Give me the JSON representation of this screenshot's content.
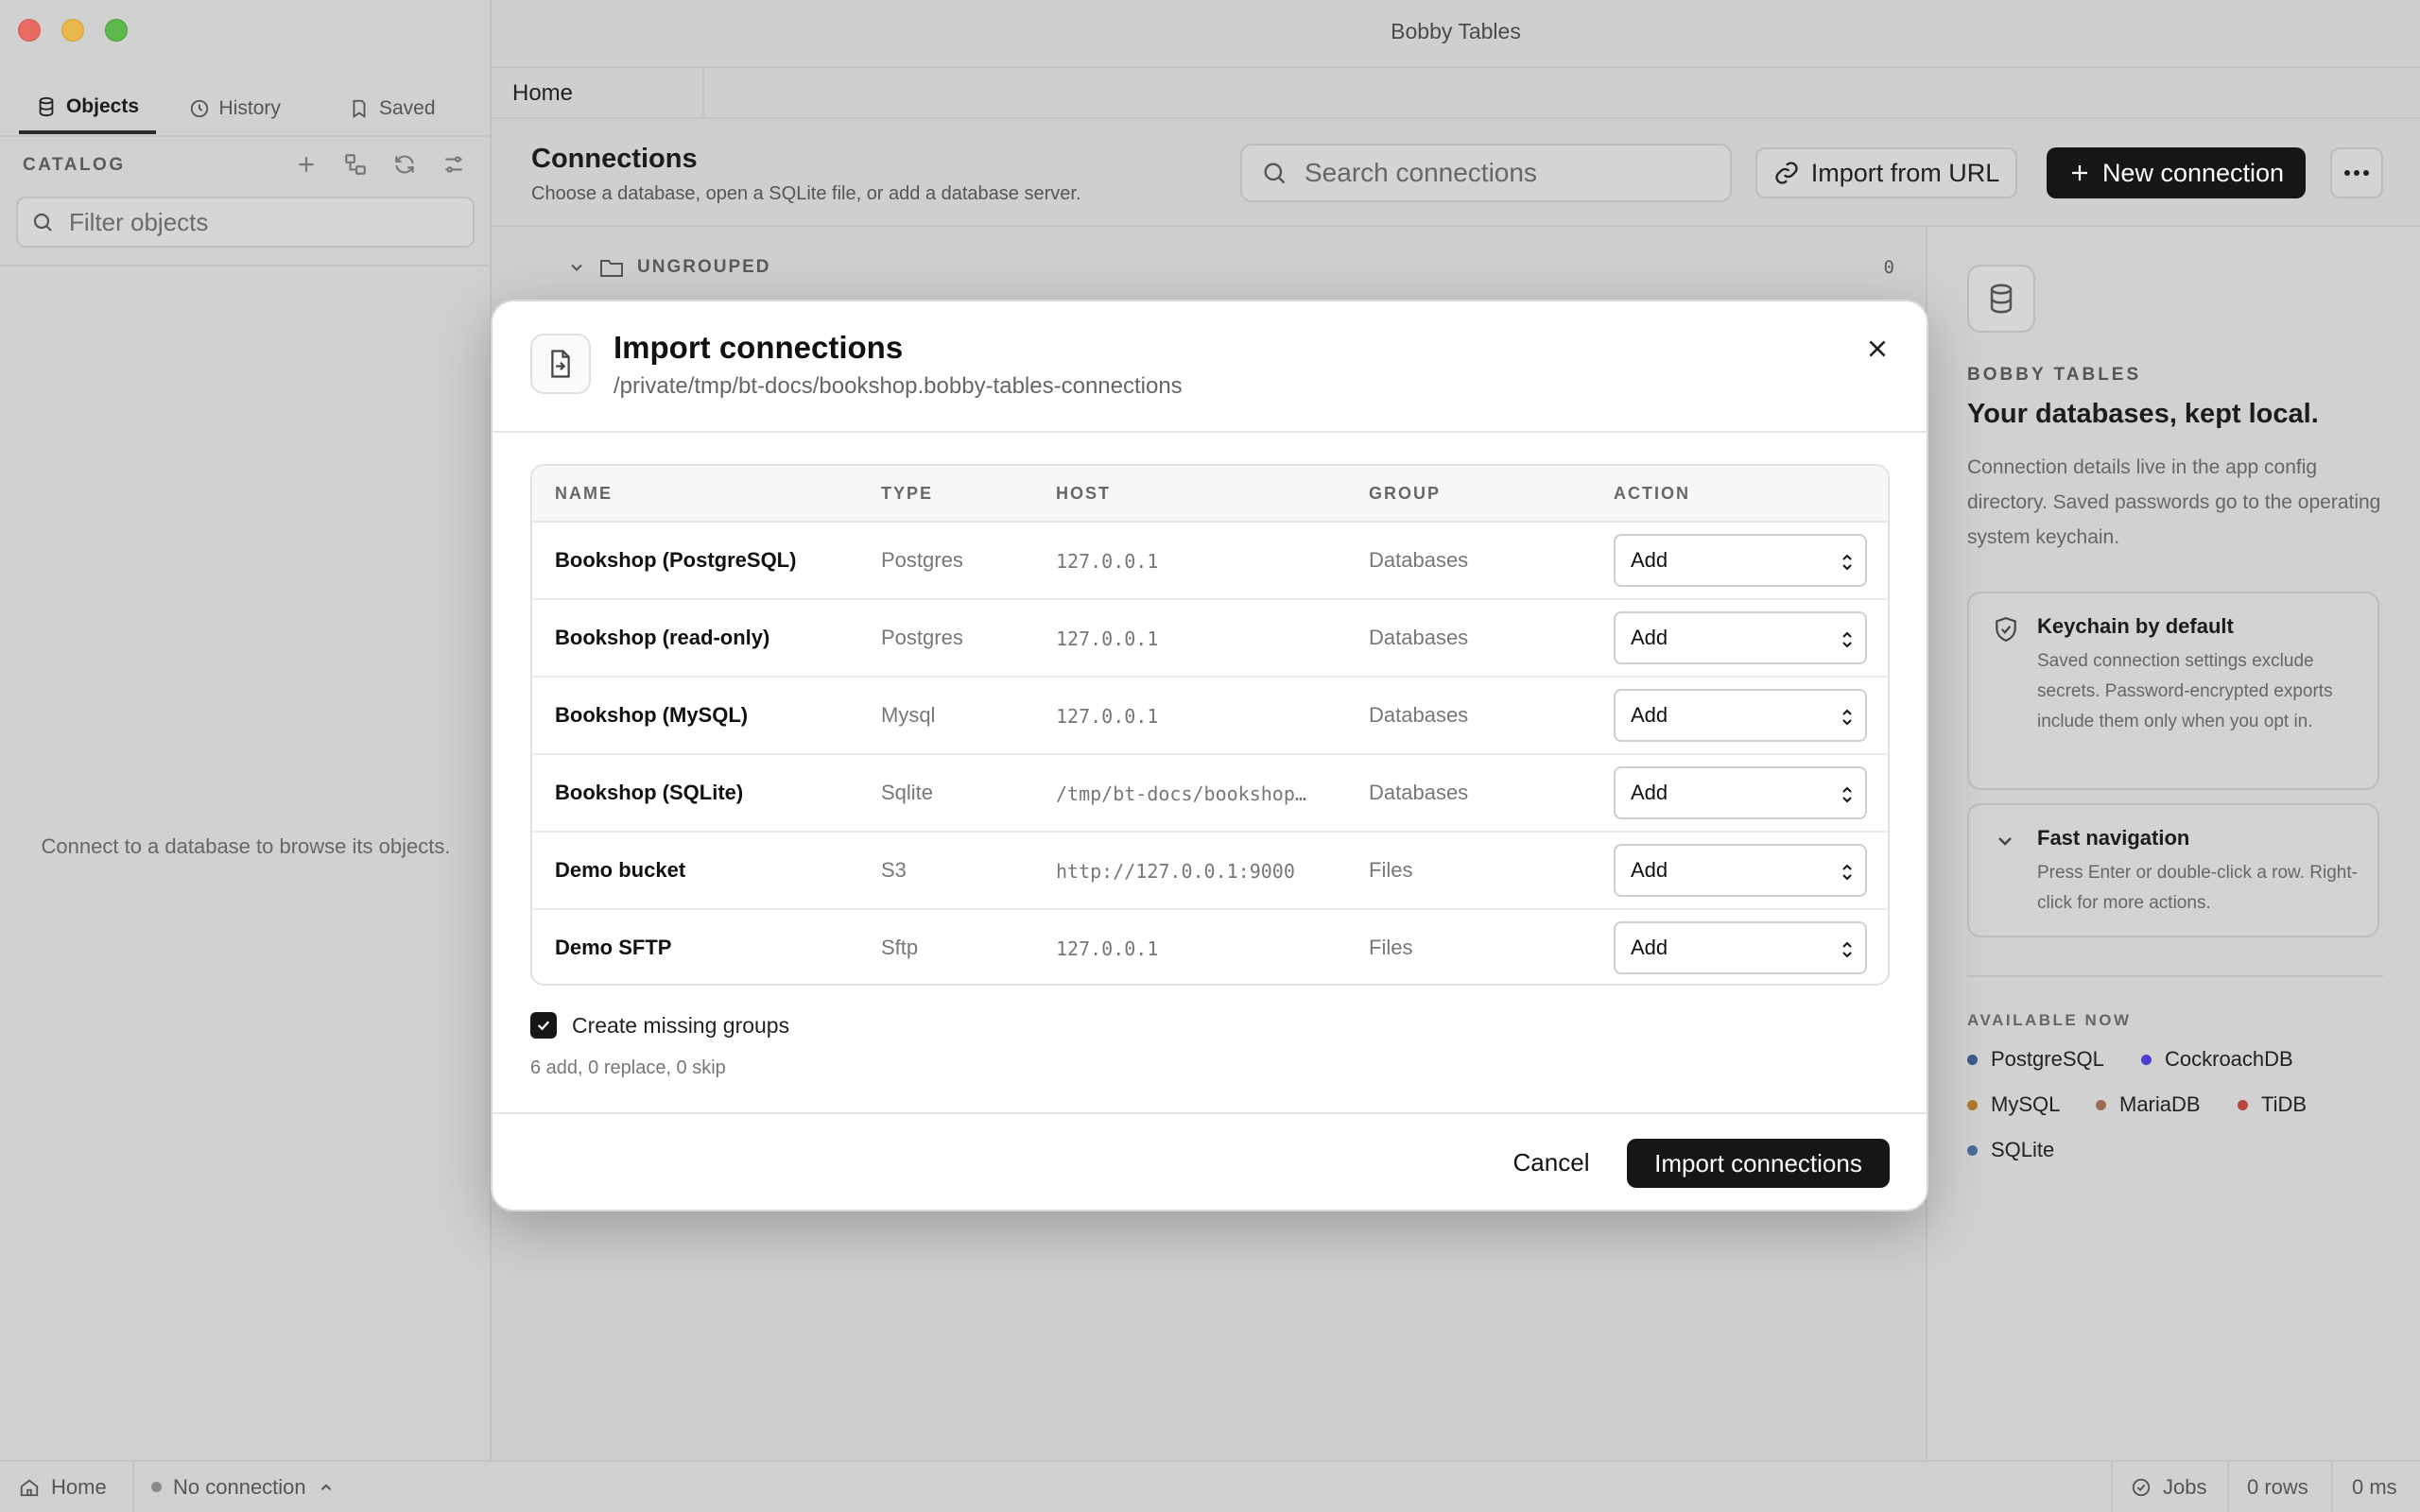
{
  "window": {
    "title": "Bobby Tables"
  },
  "sidebar": {
    "tabs": [
      {
        "label": "Objects",
        "icon": "database-icon",
        "active": true
      },
      {
        "label": "History",
        "icon": "clock-icon",
        "active": false
      },
      {
        "label": "Saved",
        "icon": "bookmark-icon",
        "active": false
      }
    ],
    "catalog_label": "CATALOG",
    "filter_placeholder": "Filter objects",
    "empty_message": "Connect to a database to browse its objects."
  },
  "doc_tabs": [
    {
      "label": "Home"
    }
  ],
  "connections": {
    "title": "Connections",
    "subtitle": "Choose a database, open a SQLite file, or add a database server.",
    "search_placeholder": "Search connections",
    "import_url_label": "Import from URL",
    "new_connection_label": "New connection",
    "group": {
      "label": "UNGROUPED",
      "count": "0"
    }
  },
  "right_panel": {
    "eyebrow": "BOBBY TABLES",
    "title": "Your databases, kept local.",
    "body": "Connection details live in the app config directory. Saved passwords go to the operating system keychain.",
    "cards": [
      {
        "title": "Keychain by default",
        "body": "Saved connection settings exclude secrets. Password-encrypted exports include them only when you opt in.",
        "icon": "shield-icon"
      },
      {
        "title": "Fast navigation",
        "body": "Press Enter or double-click a row. Right-click for more actions.",
        "icon": "chevron-down-icon"
      }
    ],
    "available_label": "AVAILABLE NOW",
    "databases": [
      {
        "name": "PostgreSQL",
        "color": "#3d5a8c"
      },
      {
        "name": "CockroachDB",
        "color": "#4b3fd1"
      },
      {
        "name": "MySQL",
        "color": "#b07a2c"
      },
      {
        "name": "MariaDB",
        "color": "#9a6b55"
      },
      {
        "name": "TiDB",
        "color": "#b5483d"
      },
      {
        "name": "SQLite",
        "color": "#4c6b99"
      }
    ]
  },
  "statusbar": {
    "home_label": "Home",
    "connection_label": "No connection",
    "jobs_label": "Jobs",
    "rows_label": "0 rows",
    "time_label": "0 ms"
  },
  "modal": {
    "title": "Import connections",
    "path": "/private/tmp/bt-docs/bookshop.bobby-tables-connections",
    "columns": {
      "name": "NAME",
      "type": "TYPE",
      "host": "HOST",
      "group": "GROUP",
      "action": "ACTION"
    },
    "rows": [
      {
        "name": "Bookshop (PostgreSQL)",
        "type": "Postgres",
        "host": "127.0.0.1",
        "group": "Databases",
        "action": "Add"
      },
      {
        "name": "Bookshop (read-only)",
        "type": "Postgres",
        "host": "127.0.0.1",
        "group": "Databases",
        "action": "Add"
      },
      {
        "name": "Bookshop (MySQL)",
        "type": "Mysql",
        "host": "127.0.0.1",
        "group": "Databases",
        "action": "Add"
      },
      {
        "name": "Bookshop (SQLite)",
        "type": "Sqlite",
        "host": "/tmp/bt-docs/bookshop…",
        "group": "Databases",
        "action": "Add"
      },
      {
        "name": "Demo bucket",
        "type": "S3",
        "host": "http://127.0.0.1:9000",
        "group": "Files",
        "action": "Add"
      },
      {
        "name": "Demo SFTP",
        "type": "Sftp",
        "host": "127.0.0.1",
        "group": "Files",
        "action": "Add"
      }
    ],
    "create_groups_label": "Create missing groups",
    "create_groups_checked": true,
    "summary": "6 add, 0 replace, 0 skip",
    "cancel_label": "Cancel",
    "import_label": "Import connections"
  }
}
